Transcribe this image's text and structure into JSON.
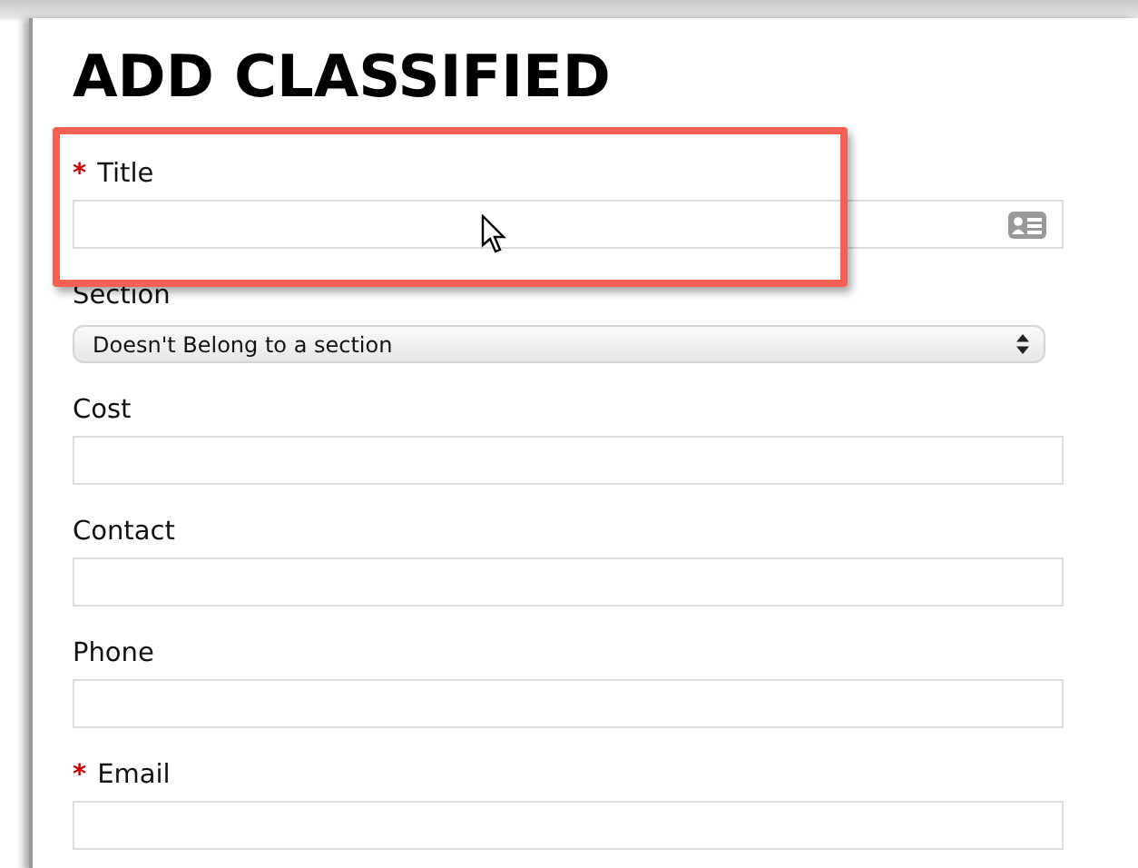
{
  "heading": "ADD CLASSIFIED",
  "fields": [
    {
      "kind": "text",
      "label": "Title",
      "required_mark": "*",
      "highlighted": true,
      "card_icon": true
    },
    {
      "kind": "select",
      "label": "Section",
      "highlighted": false,
      "value": "Doesn't Belong to a section"
    },
    {
      "kind": "text",
      "label": "Cost",
      "highlighted": false
    },
    {
      "kind": "text",
      "label": "Contact",
      "highlighted": false
    },
    {
      "kind": "text",
      "label": "Phone",
      "highlighted": false
    },
    {
      "kind": "text",
      "label": "Email",
      "required_mark": "*",
      "highlighted": false
    }
  ]
}
